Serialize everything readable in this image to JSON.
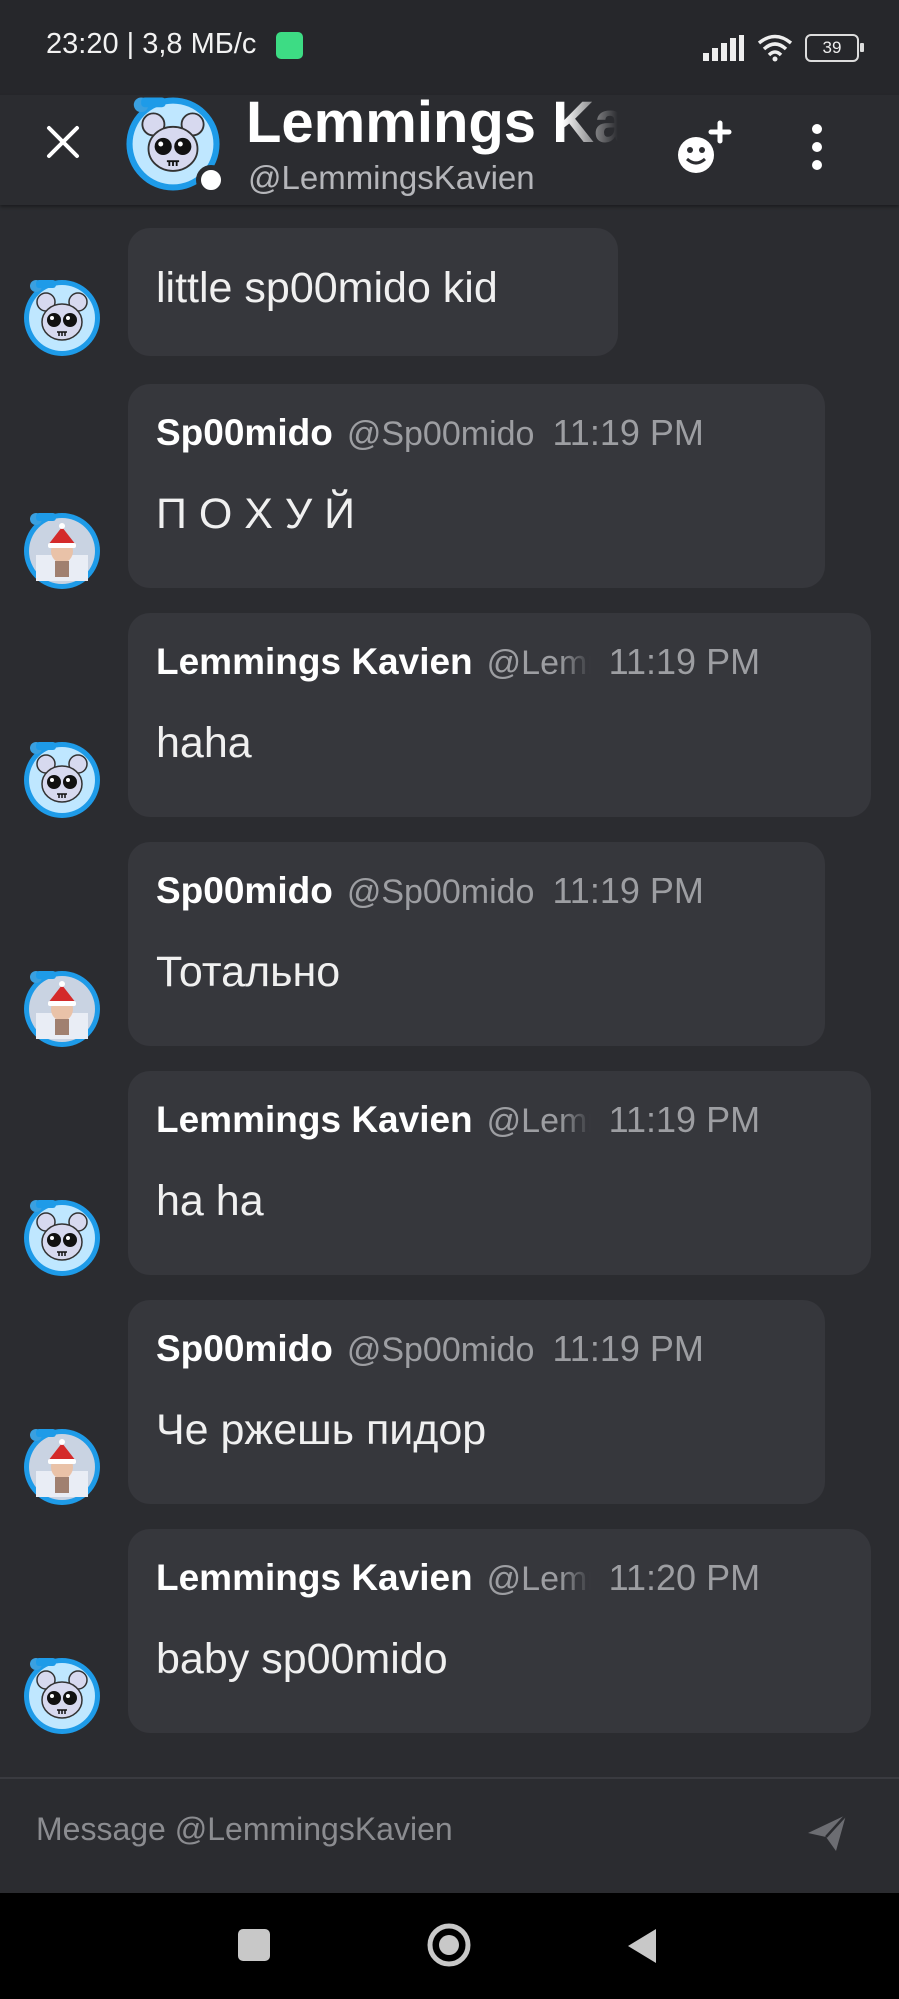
{
  "status_bar": {
    "time": "23:20 | 3,8 МБ/с",
    "battery": "39"
  },
  "header": {
    "title": "Lemmings Kavien",
    "subtitle": "@LemmingsKavien"
  },
  "messages": [
    {
      "author": "",
      "handle": "",
      "time": "",
      "text": "little sp00mido kid",
      "sender": "kavien"
    },
    {
      "author": "Sp00mido",
      "handle": "@Sp00mido",
      "time": "11:19 PM",
      "text": "П О Х У Й",
      "sender": "spoomido"
    },
    {
      "author": "Lemmings Kavien",
      "handle": "@LemmingsKavien",
      "time": "11:19 PM",
      "text": "haha",
      "sender": "kavien"
    },
    {
      "author": "Sp00mido",
      "handle": "@Sp00mido",
      "time": "11:19 PM",
      "text": "Тотально",
      "sender": "spoomido"
    },
    {
      "author": "Lemmings Kavien",
      "handle": "@LemmingsKavien",
      "time": "11:19 PM",
      "text": "ha ha",
      "sender": "kavien"
    },
    {
      "author": "Sp00mido",
      "handle": "@Sp00mido",
      "time": "11:19 PM",
      "text": "Че ржешь пидор",
      "sender": "spoomido"
    },
    {
      "author": "Lemmings Kavien",
      "handle": "@LemmingsKavien",
      "time": "11:20 PM",
      "text": "baby sp00mido",
      "sender": "kavien"
    }
  ],
  "input": {
    "placeholder": "Message @LemmingsKavien"
  },
  "colors": {
    "background": "#2b2c30",
    "bubble": "#36373c",
    "avatar_ring": "#1e9be8"
  },
  "icons": {
    "close": "close-icon",
    "add_friend": "add-friend-icon",
    "more": "more-vertical-icon",
    "send": "send-icon",
    "nav_recents": "recents-square-icon",
    "nav_home": "home-circle-icon",
    "nav_back": "back-triangle-icon"
  }
}
